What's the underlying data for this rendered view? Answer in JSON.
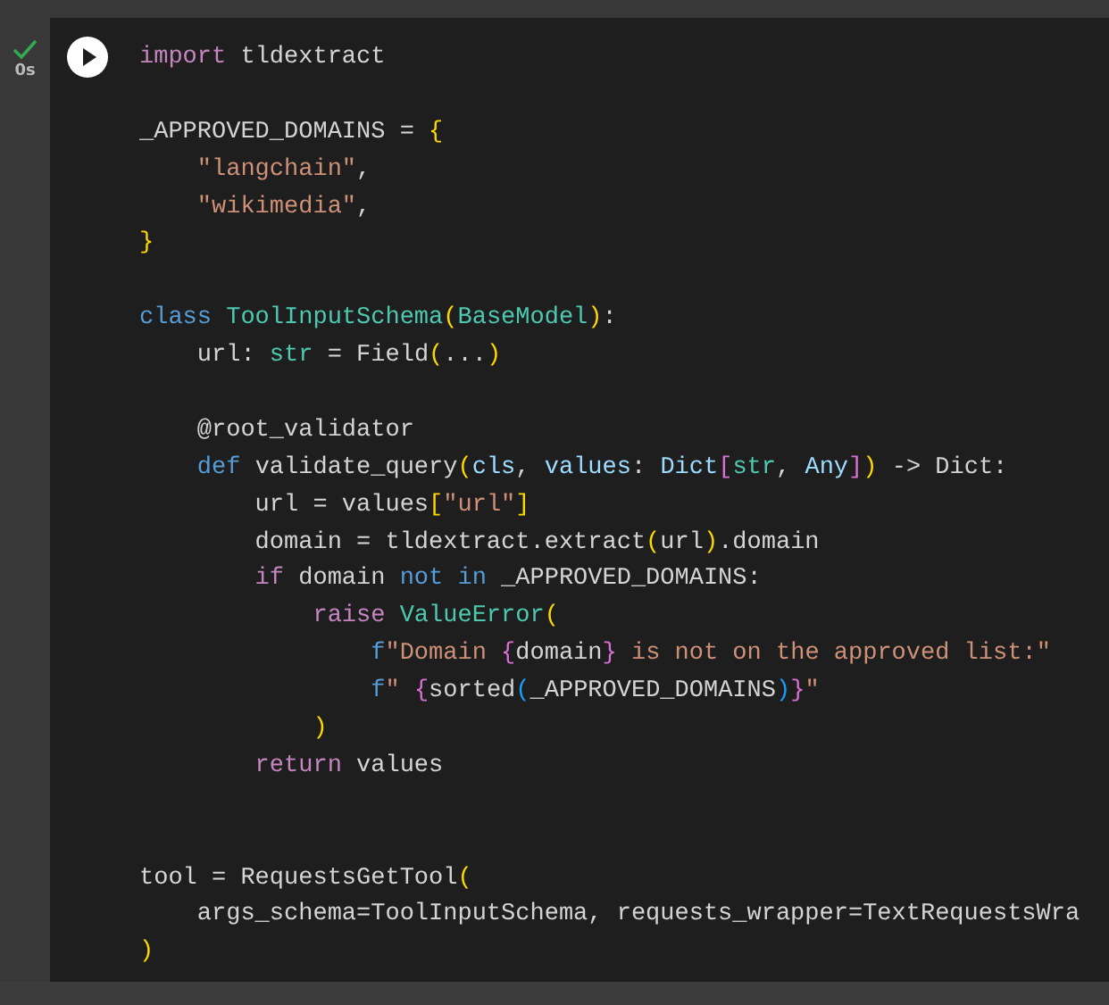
{
  "cell": {
    "status": {
      "done": true,
      "time": "0s"
    },
    "lines": [
      {
        "kind": "code",
        "tokens": [
          {
            "t": "import ",
            "kind": "control"
          },
          {
            "t": "tldextract",
            "kind": "plain"
          }
        ]
      },
      {
        "kind": "blank"
      },
      {
        "kind": "code",
        "tokens": [
          {
            "t": "_APPROVED_DOMAINS = ",
            "kind": "plain"
          },
          {
            "t": "{",
            "kind": "bracket1"
          }
        ]
      },
      {
        "kind": "code",
        "tokens": [
          {
            "t": "    \"langchain\"",
            "kind": "string"
          },
          {
            "t": ",",
            "kind": "plain"
          }
        ]
      },
      {
        "kind": "code",
        "tokens": [
          {
            "t": "    \"wikimedia\"",
            "kind": "string"
          },
          {
            "t": ",",
            "kind": "plain"
          }
        ]
      },
      {
        "kind": "code",
        "tokens": [
          {
            "t": "}",
            "kind": "bracket1"
          }
        ]
      },
      {
        "kind": "blank"
      },
      {
        "kind": "code",
        "tokens": [
          {
            "t": "class ",
            "kind": "keyword"
          },
          {
            "t": "ToolInputSchema",
            "kind": "type"
          },
          {
            "t": "(",
            "kind": "bracket1"
          },
          {
            "t": "BaseModel",
            "kind": "type"
          },
          {
            "t": ")",
            "kind": "bracket1"
          },
          {
            "t": ":",
            "kind": "plain"
          }
        ]
      },
      {
        "kind": "code",
        "tokens": [
          {
            "t": "    url: ",
            "kind": "plain"
          },
          {
            "t": "str",
            "kind": "type"
          },
          {
            "t": " = Field",
            "kind": "plain"
          },
          {
            "t": "(",
            "kind": "bracket1"
          },
          {
            "t": "...",
            "kind": "plain"
          },
          {
            "t": ")",
            "kind": "bracket1"
          }
        ]
      },
      {
        "kind": "blank"
      },
      {
        "kind": "code",
        "tokens": [
          {
            "t": "    @root_validator",
            "kind": "plain"
          }
        ]
      },
      {
        "kind": "code",
        "tokens": [
          {
            "t": "    def",
            "kind": "keyword"
          },
          {
            "t": " validate_query",
            "kind": "plain"
          },
          {
            "t": "(",
            "kind": "bracket1"
          },
          {
            "t": "cls",
            "kind": "param"
          },
          {
            "t": ", ",
            "kind": "plain"
          },
          {
            "t": "values",
            "kind": "param"
          },
          {
            "t": ": ",
            "kind": "plain"
          },
          {
            "t": "Dict",
            "kind": "param"
          },
          {
            "t": "[",
            "kind": "bracket2"
          },
          {
            "t": "str",
            "kind": "type"
          },
          {
            "t": ", ",
            "kind": "plain"
          },
          {
            "t": "Any",
            "kind": "param"
          },
          {
            "t": "]",
            "kind": "bracket2"
          },
          {
            "t": ")",
            "kind": "bracket1"
          },
          {
            "t": " -> Dict:",
            "kind": "plain"
          }
        ]
      },
      {
        "kind": "code",
        "tokens": [
          {
            "t": "        url = values",
            "kind": "plain"
          },
          {
            "t": "[",
            "kind": "bracket1"
          },
          {
            "t": "\"url\"",
            "kind": "string"
          },
          {
            "t": "]",
            "kind": "bracket1"
          }
        ]
      },
      {
        "kind": "code",
        "tokens": [
          {
            "t": "        domain = tldextract.extract",
            "kind": "plain"
          },
          {
            "t": "(",
            "kind": "bracket1"
          },
          {
            "t": "url",
            "kind": "plain"
          },
          {
            "t": ")",
            "kind": "bracket1"
          },
          {
            "t": ".domain",
            "kind": "plain"
          }
        ]
      },
      {
        "kind": "code",
        "tokens": [
          {
            "t": "        if",
            "kind": "control"
          },
          {
            "t": " domain ",
            "kind": "plain"
          },
          {
            "t": "not in",
            "kind": "keyword"
          },
          {
            "t": " _APPROVED_DOMAINS:",
            "kind": "plain"
          }
        ]
      },
      {
        "kind": "code",
        "tokens": [
          {
            "t": "            raise ",
            "kind": "control"
          },
          {
            "t": "ValueError",
            "kind": "type"
          },
          {
            "t": "(",
            "kind": "bracket1"
          }
        ]
      },
      {
        "kind": "code",
        "tokens": [
          {
            "t": "                f",
            "kind": "keyword"
          },
          {
            "t": "\"Domain ",
            "kind": "string"
          },
          {
            "t": "{",
            "kind": "bracket2"
          },
          {
            "t": "domain",
            "kind": "plain"
          },
          {
            "t": "}",
            "kind": "bracket2"
          },
          {
            "t": " is not on the approved list:\"",
            "kind": "string"
          }
        ]
      },
      {
        "kind": "code",
        "tokens": [
          {
            "t": "                f",
            "kind": "keyword"
          },
          {
            "t": "\" ",
            "kind": "string"
          },
          {
            "t": "{",
            "kind": "bracket2"
          },
          {
            "t": "sorted",
            "kind": "plain"
          },
          {
            "t": "(",
            "kind": "bracket3"
          },
          {
            "t": "_APPROVED_DOMAINS",
            "kind": "plain"
          },
          {
            "t": ")",
            "kind": "bracket3"
          },
          {
            "t": "}",
            "kind": "bracket2"
          },
          {
            "t": "\"",
            "kind": "string"
          }
        ]
      },
      {
        "kind": "code",
        "tokens": [
          {
            "t": "            )",
            "kind": "bracket1"
          }
        ]
      },
      {
        "kind": "code",
        "tokens": [
          {
            "t": "        return",
            "kind": "control"
          },
          {
            "t": " values",
            "kind": "plain"
          }
        ]
      },
      {
        "kind": "blank"
      },
      {
        "kind": "blank"
      },
      {
        "kind": "code",
        "tokens": [
          {
            "t": "tool = RequestsGetTool",
            "kind": "plain"
          },
          {
            "t": "(",
            "kind": "bracket1"
          }
        ]
      },
      {
        "kind": "code",
        "tokens": [
          {
            "t": "    args_schema=ToolInputSchema, requests_wrapper=TextRequestsWra",
            "kind": "plain"
          }
        ]
      },
      {
        "kind": "code",
        "tokens": [
          {
            "t": ")",
            "kind": "bracket1"
          }
        ]
      }
    ]
  }
}
